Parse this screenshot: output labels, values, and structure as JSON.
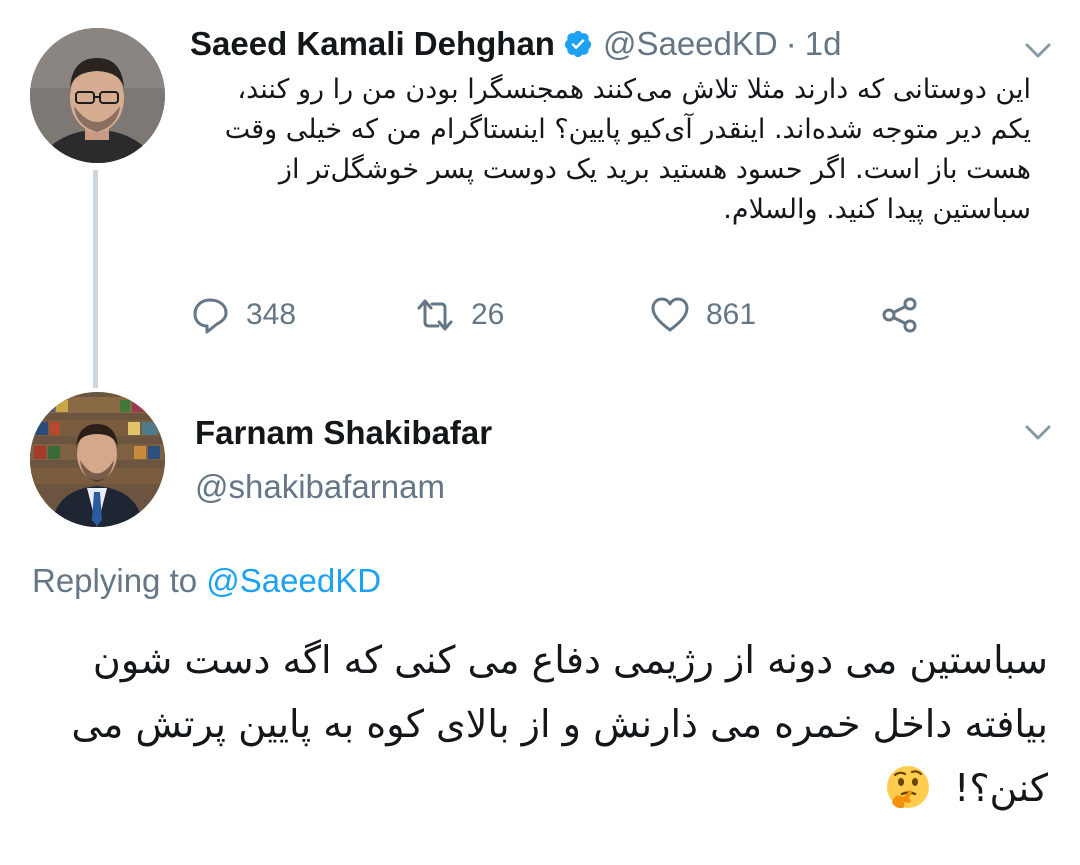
{
  "thread": {
    "original": {
      "author_name": "Saeed Kamali Dehghan",
      "handle": "@SaeedKD",
      "separator": "·",
      "time": "1d",
      "text": "این دوستانی که دارند مثلا تلاش می‌کنند همجنسگرا بودن من را رو کنند، یکم دیر متوجه شده‌اند. اینقدر آی‌کیو پایین؟ اینستاگرام من که خیلی وقت هست باز است. اگر حسود هستید برید یک دوست پسر خوشگل‌تر از سباستین پیدا کنید. والسلام.",
      "reply_count": "348",
      "retweet_count": "26",
      "like_count": "861",
      "icons": {
        "verified": "verified-badge-icon",
        "reply": "reply-icon",
        "retweet": "retweet-icon",
        "like": "heart-icon",
        "share": "share-icon",
        "menu": "chevron-down-icon"
      }
    },
    "reply": {
      "author_name": "Farnam Shakibafar",
      "handle": "@shakibafarnam",
      "replying_prefix": "Replying to",
      "replying_to": "@SaeedKD",
      "text": "سباستین می دونه از رژیمی دفاع می کنی که اگه دست شون بیافته داخل خمره می ذارنش و از بالای کوه به پایین پرتش می کنن؟!",
      "emoji": "thinking-face-emoji"
    }
  },
  "colors": {
    "text": "#14171a",
    "secondary": "#657786",
    "accent": "#1da1f2",
    "thread_line": "#cdd6dd"
  }
}
